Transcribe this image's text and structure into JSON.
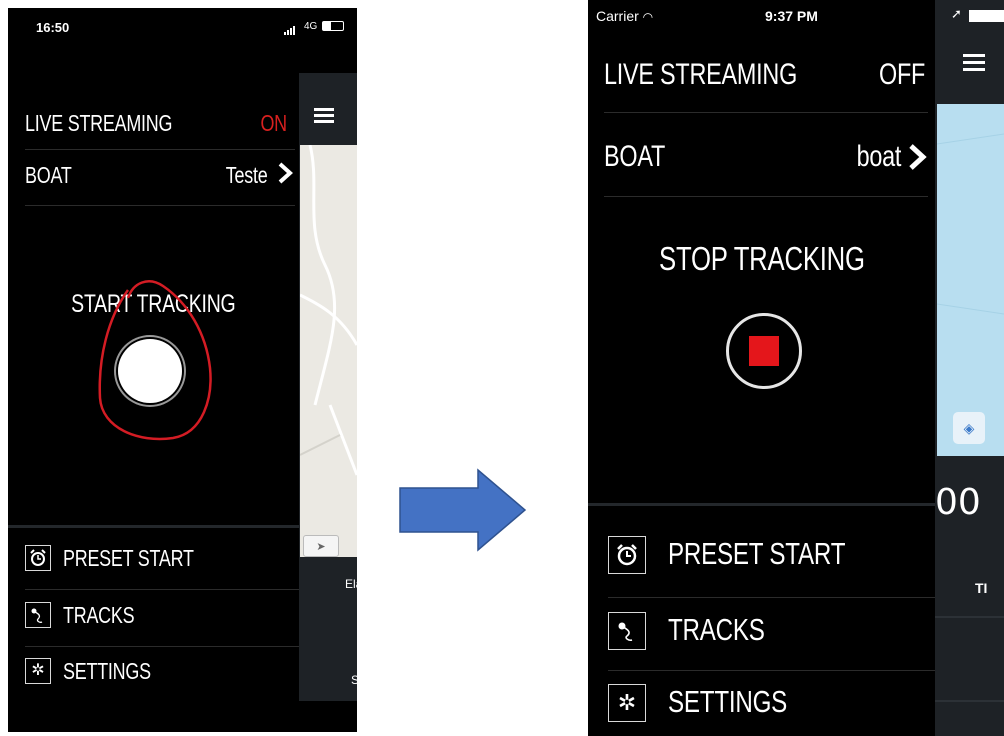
{
  "left_phone": {
    "status": {
      "time": "16:50",
      "network": "4G"
    },
    "live_streaming": {
      "label": "LIVE STREAMING",
      "value": "ON",
      "value_color": "#d8201f"
    },
    "boat": {
      "label": "BOAT",
      "value": "Teste"
    },
    "tracking_label": "START TRACKING",
    "menu": [
      {
        "label": "PRESET START",
        "icon": "alarm-clock-icon"
      },
      {
        "label": "TRACKS",
        "icon": "track-icon"
      },
      {
        "label": "SETTINGS",
        "icon": "gear-icon"
      }
    ],
    "map_panel": {
      "label_1": "Ela",
      "label_2": "S"
    }
  },
  "right_phone": {
    "status": {
      "carrier": "Carrier",
      "time": "9:37 PM"
    },
    "live_streaming": {
      "label": "LIVE STREAMING",
      "value": "OFF"
    },
    "boat": {
      "label": "BOAT",
      "value": "boat"
    },
    "tracking_label": "STOP TRACKING",
    "stop_color": "#e4161b",
    "menu": [
      {
        "label": "PRESET START",
        "icon": "alarm-clock-icon"
      },
      {
        "label": "TRACKS",
        "icon": "track-icon"
      },
      {
        "label": "SETTINGS",
        "icon": "gear-icon"
      }
    ],
    "map_panel": {
      "counter": "00",
      "label": "TI"
    }
  },
  "arrow": {
    "color": "#4472c4"
  }
}
